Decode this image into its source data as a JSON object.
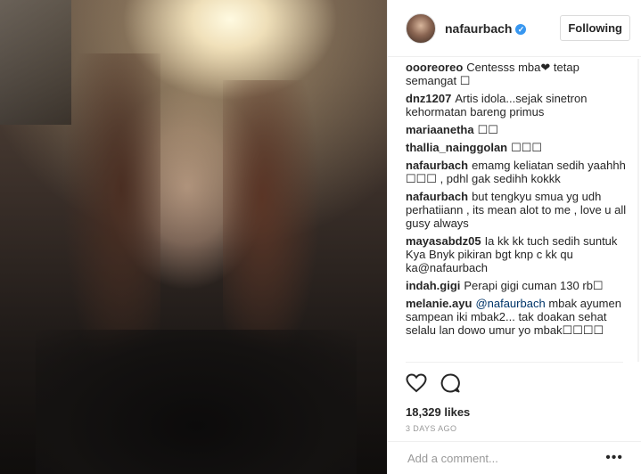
{
  "post": {
    "username": "nafaurbach",
    "verified_icon": "verified-badge-icon",
    "follow_label": "Following",
    "likes": "18,329 likes",
    "timestamp": "3 DAYS AGO",
    "comment_placeholder": "Add a comment..."
  },
  "comments": [
    {
      "user": "oooreoreo",
      "text": "Centesss mba❤ tetap semangat ☐"
    },
    {
      "user": "dnz1207",
      "text": "Artis idola...sejak sinetron kehormatan bareng primus"
    },
    {
      "user": "mariaanetha",
      "text": "☐☐"
    },
    {
      "user": "thallia_nainggolan",
      "text": "☐☐☐"
    },
    {
      "user": "nafaurbach",
      "text": "emamg keliatan sedih yaahhh ☐☐☐ , pdhl gak sedihh kokkk"
    },
    {
      "user": "nafaurbach",
      "text": "but tengkyu smua yg udh perhatiiann , its mean alot to me , love u all gusy always"
    },
    {
      "user": "mayasabdz05",
      "text": "Ia kk kk tuch sedih suntuk Kya Bnyk pikiran bgt knp c kk qu ka@nafaurbach"
    },
    {
      "user": "indah.gigi",
      "text": "Perapi gigi cuman 130 rb☐"
    },
    {
      "user": "melanie.ayu",
      "mention": "@nafaurbach",
      "text": "mbak ayumen sampean iki mbak2... tak doakan sehat selalu lan dowo umur yo mbak☐☐☐☐"
    }
  ]
}
